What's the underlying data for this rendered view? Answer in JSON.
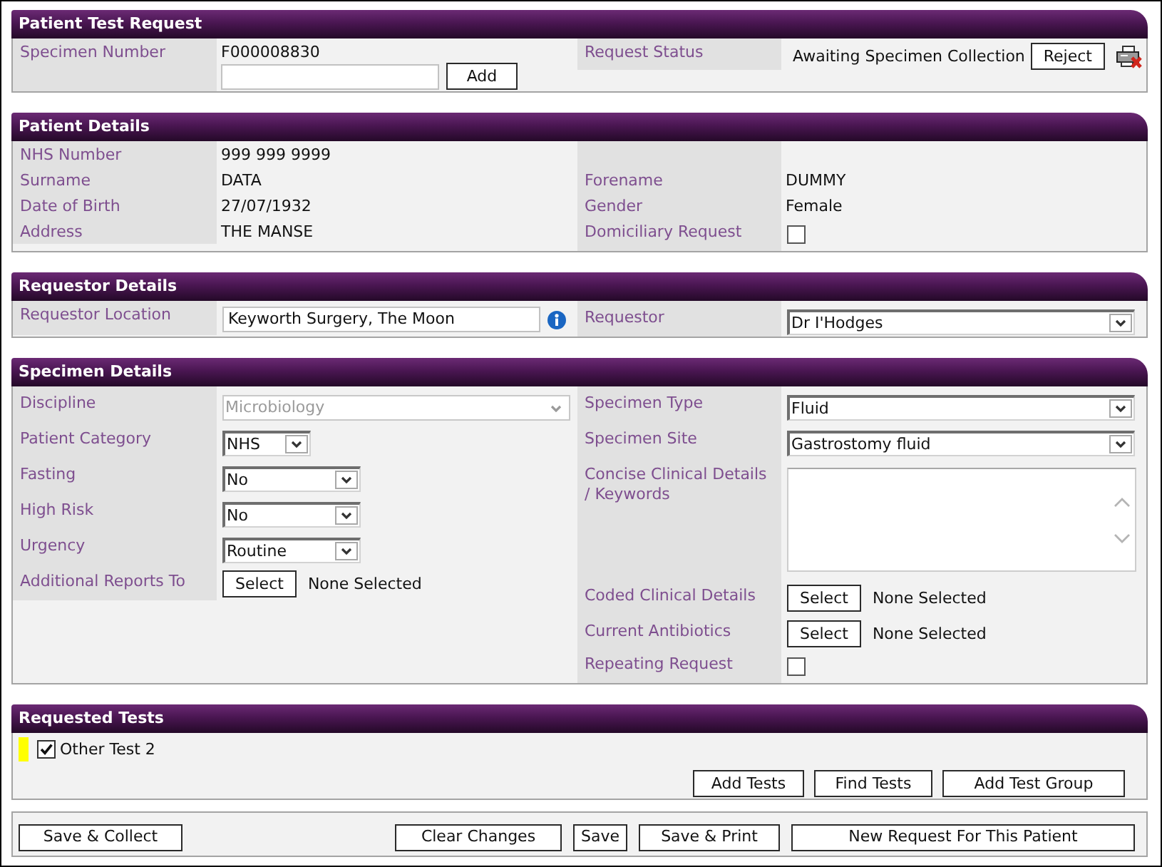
{
  "sections": [
    {
      "title": "Patient Test Request",
      "left": [
        {
          "label": "Specimen Number",
          "kind": "entry",
          "value": "F000008830",
          "button": "Add"
        }
      ],
      "right": [
        {
          "label": "Request Status",
          "kind": "status",
          "value": "Awaiting Specimen Collection",
          "button": "Reject"
        }
      ]
    },
    {
      "title": "Patient Details",
      "left": [
        {
          "label": "NHS Number",
          "kind": "text",
          "value": "999 999 9999"
        },
        {
          "label": "Surname",
          "kind": "text",
          "value": "DATA"
        },
        {
          "label": "Date of Birth",
          "kind": "text",
          "value": "27/07/1932"
        },
        {
          "label": "Address",
          "kind": "text",
          "value": "THE MANSE"
        }
      ],
      "right": [
        {
          "label": "Forename",
          "kind": "text",
          "value": "DUMMY"
        },
        {
          "label": "Gender",
          "kind": "text",
          "value": "Female"
        },
        {
          "label": "Domiciliary Request",
          "kind": "checkbox",
          "checked": false
        }
      ]
    },
    {
      "title": "Requestor Details",
      "left": [
        {
          "label": "Requestor Location",
          "kind": "input",
          "value": "Keyworth Surgery, The Moon"
        }
      ],
      "right": [
        {
          "label": "Requestor",
          "kind": "select",
          "value": "Dr I'Hodges",
          "disabled": false
        }
      ]
    },
    {
      "title": "Specimen Details",
      "left": [
        {
          "label": "Discipline",
          "kind": "select",
          "value": "Microbiology",
          "disabled": true
        },
        {
          "label": "Patient Category",
          "kind": "mini_select",
          "value": "NHS",
          "disabled": false
        },
        {
          "label": "Fasting",
          "kind": "short_select",
          "value": "No",
          "disabled": false
        },
        {
          "label": "High Risk",
          "kind": "short_select",
          "value": "No",
          "disabled": false
        },
        {
          "label": "Urgency",
          "kind": "short_select",
          "value": "Routine",
          "disabled": false
        },
        {
          "label": "Additional Reports To",
          "kind": "picker",
          "button": "Select",
          "value": "None Selected"
        }
      ],
      "right": [
        {
          "label": "Specimen Type",
          "kind": "select",
          "value": "Fluid",
          "disabled": false
        },
        {
          "label": "Specimen Site",
          "kind": "select",
          "value": "Gastrostomy fluid",
          "disabled": false
        },
        {
          "label": "Concise Clinical Details / Keywords",
          "kind": "textarea"
        },
        {
          "label": "Coded Clinical Details",
          "kind": "picker",
          "button": "Select",
          "value": "None Selected"
        },
        {
          "label": "Current Antibiotics",
          "kind": "picker",
          "button": "Select",
          "value": "None Selected"
        },
        {
          "label": "Repeating Request",
          "kind": "checkbox",
          "checked": false
        }
      ]
    }
  ],
  "requested_tests": {
    "title": "Requested Tests",
    "tests": [
      {
        "name": "Other Test 2",
        "checked": true,
        "color": "#ffff00"
      }
    ],
    "buttons": [
      "Add Tests",
      "Find Tests",
      "Add Test Group"
    ]
  },
  "footer_buttons": [
    "Save & Collect",
    "Clear Changes",
    "Save",
    "Save & Print",
    "New Request For This Patient"
  ]
}
